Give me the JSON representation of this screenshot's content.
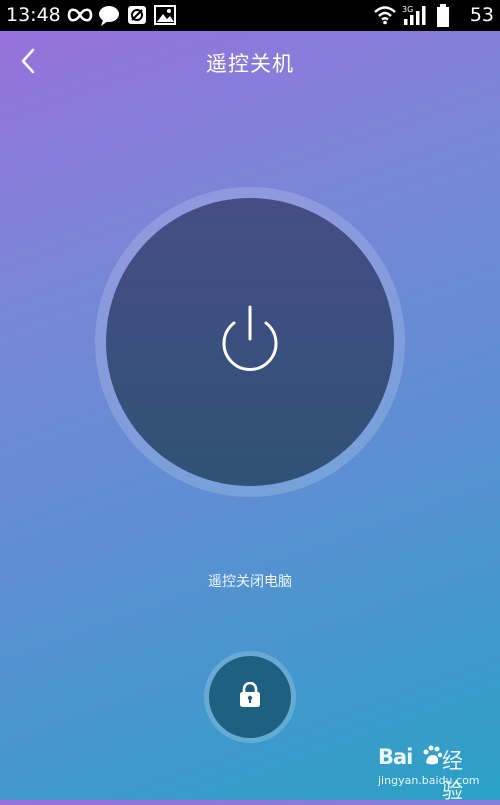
{
  "status_bar": {
    "time": "13:48",
    "battery_level": "53",
    "network_type": "3G",
    "icons": [
      "infinity-icon",
      "chat-bubble-icon",
      "blocked-icon",
      "image-icon",
      "wifi-icon",
      "signal-icon",
      "battery-icon"
    ]
  },
  "header": {
    "title": "遥控关机",
    "back_icon": "chevron-left-icon"
  },
  "main": {
    "power_icon": "power-icon",
    "action_label": "遥控关闭电脑",
    "lock_icon": "lock-icon"
  },
  "watermark": {
    "brand": "Bai",
    "brand_suffix": "经验",
    "url": "jingyan.baidu.com"
  },
  "colors": {
    "gradient_start": "#9a6fdc",
    "gradient_end": "#2aa1c6",
    "power_button": "#3d4f80",
    "lock_button": "#1f5f80"
  }
}
